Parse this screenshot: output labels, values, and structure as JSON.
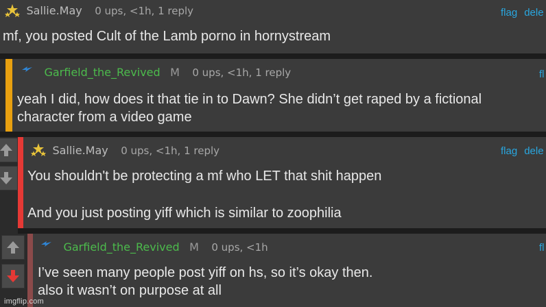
{
  "comments": [
    {
      "author": "Sallie.May",
      "meta": "0 ups, <1h, 1 reply",
      "actions": [
        "flag",
        "dele"
      ],
      "body": [
        "mf, you posted Cult of the Lamb porno in hornystream"
      ]
    },
    {
      "author": "Garfield_the_Revived",
      "mod_badge": "M",
      "meta": "0 ups, <1h, 1 reply",
      "actions": [
        "fl"
      ],
      "body": [
        "yeah I did, how does it that tie in to Dawn? She didn’t get raped by a fictional",
        "character from a video game"
      ]
    },
    {
      "author": "Sallie.May",
      "meta": "0 ups, <1h, 1 reply",
      "actions": [
        "flag",
        "dele"
      ],
      "body": [
        "You shouldn't be protecting a mf who LET that shit happen",
        "And you just posting yiff which is similar to zoophilia"
      ]
    },
    {
      "author": "Garfield_the_Revived",
      "mod_badge": "M",
      "meta": "0 ups, <1h",
      "actions": [
        "fl"
      ],
      "body": [
        "I’ve seen many people post yiff on hs, so it’s okay then.",
        "also it wasn’t on purpose at all"
      ]
    }
  ],
  "watermark": "imgflip.com",
  "colors": {
    "depth1_bar": "#e8a010",
    "depth2_bar": "#e53935",
    "depth3_bar": "#8b4a4a",
    "link": "#29a7e0",
    "username_green": "#4cbb4c",
    "downvote_active": "#e53935"
  },
  "icons": {
    "sallie_avatar": "stars-icon",
    "garfield_avatar": "blue-lightning-icon",
    "upvote": "up-arrow-icon",
    "downvote": "down-arrow-icon"
  }
}
